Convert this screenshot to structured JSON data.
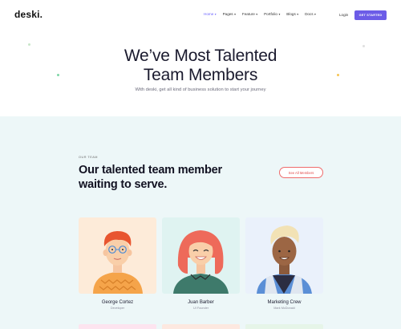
{
  "header": {
    "logo": "deski.",
    "nav": [
      {
        "label": "Home",
        "active": true
      },
      {
        "label": "Pages",
        "active": false
      },
      {
        "label": "Feature",
        "active": false
      },
      {
        "label": "Portfolio",
        "active": false
      },
      {
        "label": "Blogs",
        "active": false
      },
      {
        "label": "Docs",
        "active": false
      }
    ],
    "caret": "▾",
    "login_label": "Login",
    "cta_label": "GET STARTED"
  },
  "hero": {
    "title_line1": "We’ve Most Talented",
    "title_line2": "Team Members",
    "subtitle": "With deski, get all kind of business solution to start your journey"
  },
  "team": {
    "eyebrow": "OUR TEAM",
    "title_line1": "Our talented team member",
    "title_line2": "waiting to serve.",
    "see_all_label": "See All Members",
    "members": [
      {
        "name": "George Cortez",
        "role": "Developer",
        "bg": "#fdebd9"
      },
      {
        "name": "Juan Barber",
        "role": "UI Founder",
        "bg": "#dff3f1"
      },
      {
        "name": "Marketing Crew",
        "role": "Mark McDonald",
        "bg": "#eaf1fb"
      }
    ]
  },
  "colors": {
    "accent": "#6c5ce7",
    "see_all_border": "#ef6b6b",
    "section_bg": "#edf7f8"
  }
}
